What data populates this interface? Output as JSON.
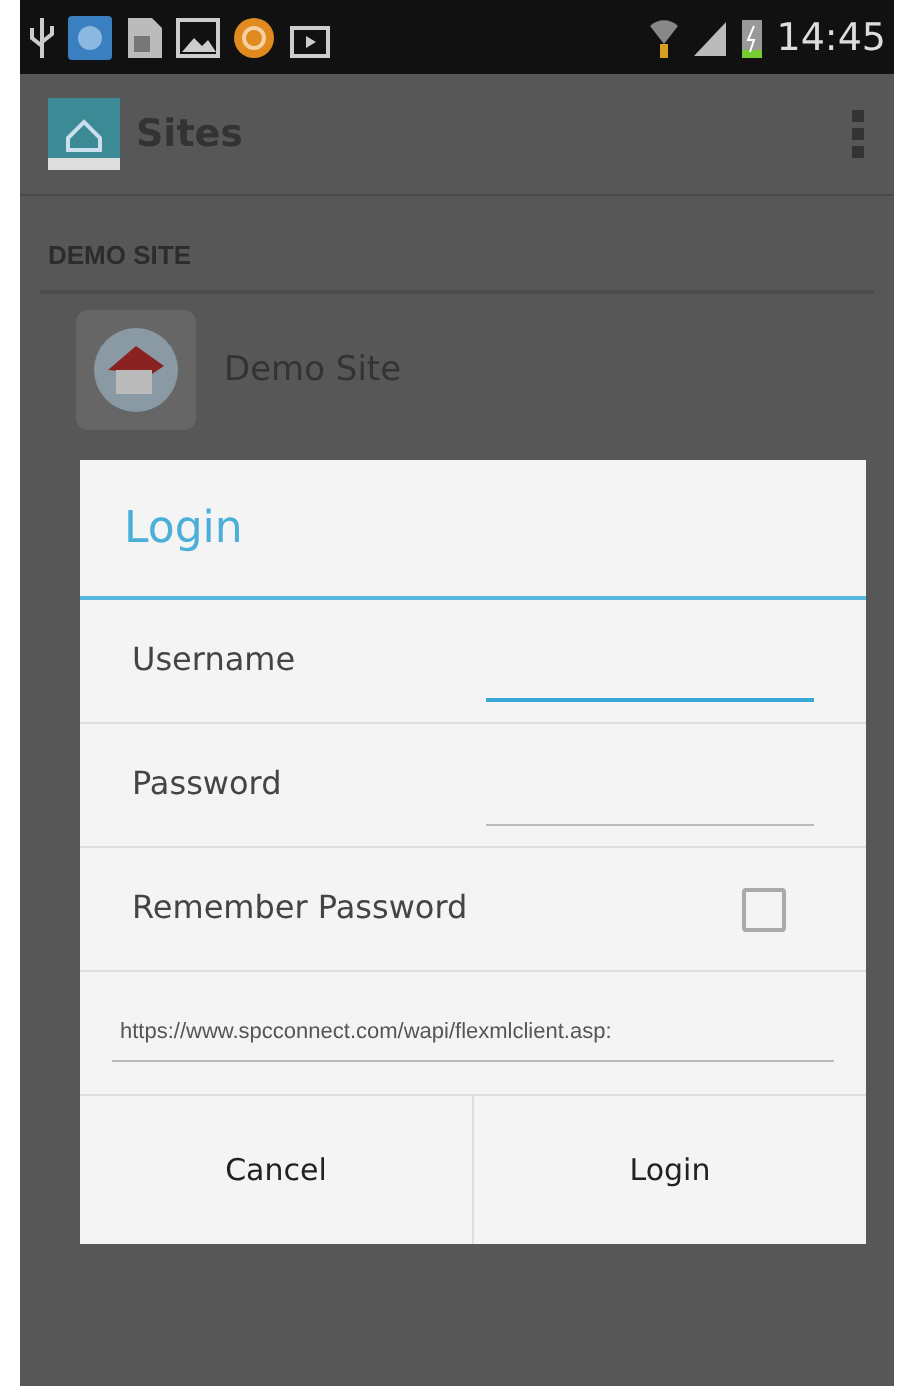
{
  "status_bar": {
    "time": "14:45"
  },
  "action_bar": {
    "title": "Sites"
  },
  "section": {
    "header": "DEMO SITE"
  },
  "sites": [
    {
      "name": "Demo Site"
    }
  ],
  "dialog": {
    "title": "Login",
    "fields": [
      {
        "kind": "text",
        "label": "Username",
        "focused": true
      },
      {
        "kind": "text",
        "label": "Password",
        "focused": false
      },
      {
        "kind": "checkbox",
        "label": "Remember Password",
        "checked": false
      },
      {
        "kind": "url",
        "value": "https://www.spcconnect.com/wapi/flexmlclient.asp:"
      }
    ],
    "buttons": [
      "Cancel",
      "Login"
    ]
  }
}
